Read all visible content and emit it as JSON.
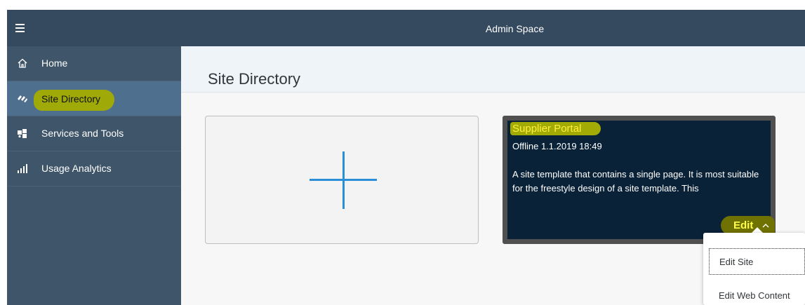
{
  "shell": {
    "title": "Admin Space",
    "menu_icon": "hamburger-icon"
  },
  "sidebar": {
    "items": [
      {
        "label": "Home",
        "icon": "home-icon",
        "active": false
      },
      {
        "label": "Site Directory",
        "icon": "site-directory-icon",
        "active": true
      },
      {
        "label": "Services and Tools",
        "icon": "puzzle-icon",
        "active": false
      },
      {
        "label": "Usage Analytics",
        "icon": "bar-chart-icon",
        "active": false
      }
    ]
  },
  "main": {
    "page_title": "Site Directory",
    "add_tile": {
      "icon": "plus-icon"
    },
    "site_tile": {
      "title": "Supplier Portal",
      "status": "Offline 1.1.2019 18:49",
      "description": "A site template that contains a single page. It is most suitable for the freestyle design of a site template. This",
      "edit_label": "Edit",
      "edit_icon": "chevron-up-icon"
    },
    "edit_menu": {
      "items": [
        {
          "label": "Edit Site"
        },
        {
          "label": "Edit Web Content"
        }
      ]
    }
  },
  "colors": {
    "shell_bar": "#354a5f",
    "sidebar": "#3f5569",
    "sidebar_active": "#4e6f8d",
    "tile_dark": "#0a2238",
    "accent_blue": "#2a8fd6",
    "highlight": "#a2ab06"
  }
}
